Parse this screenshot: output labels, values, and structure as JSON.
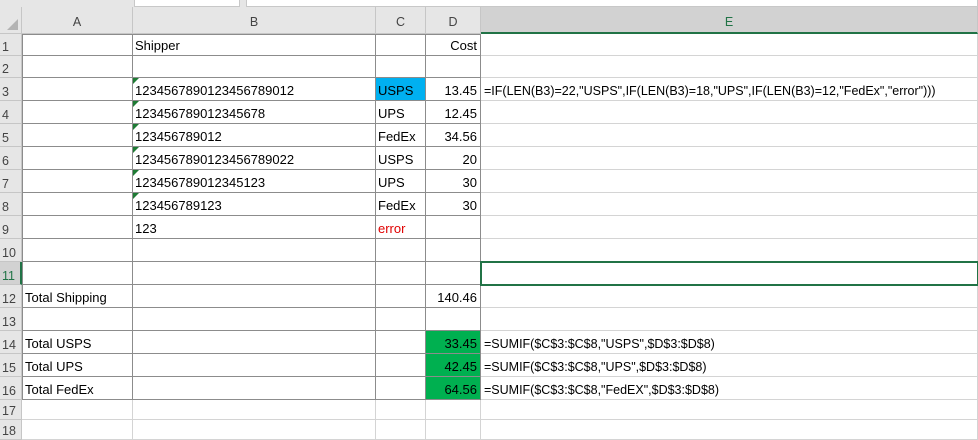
{
  "columns": [
    "A",
    "B",
    "C",
    "D",
    "E"
  ],
  "rows": [
    "1",
    "2",
    "3",
    "4",
    "5",
    "6",
    "7",
    "8",
    "9",
    "10",
    "11",
    "12",
    "13",
    "14",
    "15",
    "16",
    "17",
    "18"
  ],
  "cells": {
    "B1": "Shipper",
    "D1": "Cost",
    "B3": "1234567890123456789012",
    "C3": "USPS",
    "D3": "13.45",
    "E3": "=IF(LEN(B3)=22,\"USPS\",IF(LEN(B3)=18,\"UPS\",IF(LEN(B3)=12,\"FedEx\",\"error\")))",
    "B4": "123456789012345678",
    "C4": "UPS",
    "D4": "12.45",
    "B5": "123456789012",
    "C5": "FedEx",
    "D5": "34.56",
    "B6": "1234567890123456789022",
    "C6": "USPS",
    "D6": "20",
    "B7": "123456789012345123",
    "C7": "UPS",
    "D7": "30",
    "B8": "123456789123",
    "C8": "FedEx",
    "D8": "30",
    "B9": "123",
    "C9": "error",
    "A12": "Total Shipping",
    "D12": "140.46",
    "A14": "Total USPS",
    "D14": "33.45",
    "E14": "=SUMIF($C$3:$C$8,\"USPS\",$D$3:$D$8)",
    "A15": "Total UPS",
    "D15": "42.45",
    "E15": "=SUMIF($C$3:$C$8,\"UPS\",$D$3:$D$8)",
    "A16": "Total FedEx",
    "D16": "64.56",
    "E16": "=SUMIF($C$3:$C$8,\"FedEX\",$D$3:$D$8)"
  },
  "colors": {
    "usps_fill": "#00b0f0",
    "total_fill": "#00b050",
    "error_text": "#e00000",
    "selection": "#217346",
    "error_indicator": "#1e7b34"
  },
  "selected_cell": "E11"
}
